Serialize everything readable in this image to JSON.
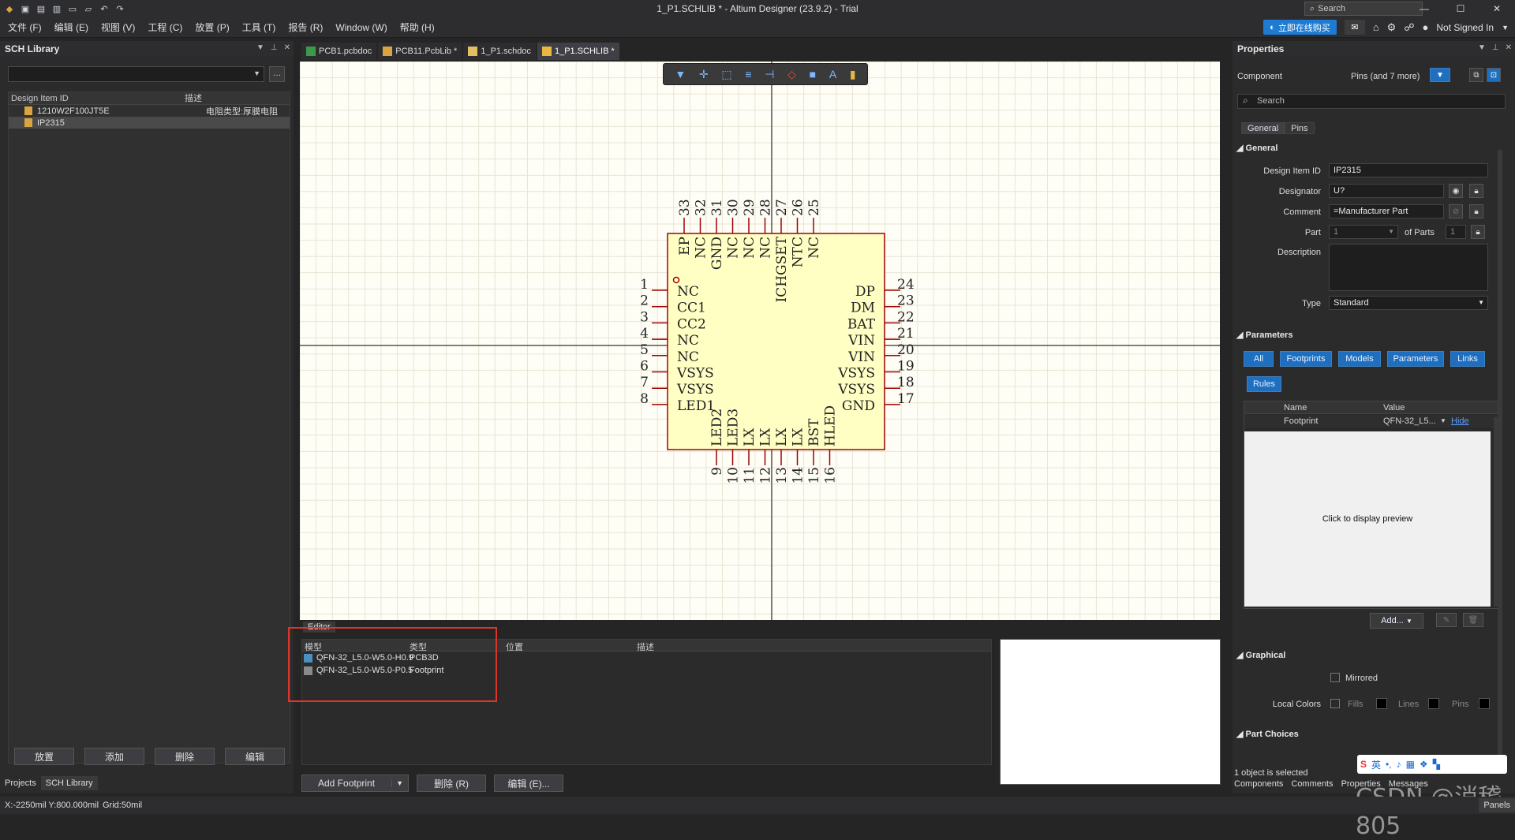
{
  "app": {
    "title": "1_P1.SCHLIB * - Altium Designer (23.9.2) - Trial",
    "search_placeholder": "Search",
    "buy_label": "立即在线购买",
    "signed_in": "Not Signed In"
  },
  "menu": [
    "文件 (F)",
    "编辑 (E)",
    "视图 (V)",
    "工程 (C)",
    "放置 (P)",
    "工具 (T)",
    "报告 (R)",
    "Window (W)",
    "帮助 (H)"
  ],
  "left_panel": {
    "title": "SCH Library",
    "col_id": "Design Item ID",
    "col_desc": "描述",
    "items": [
      {
        "id": "1210W2F100JT5E",
        "desc": "电阻类型:厚膜电阻"
      },
      {
        "id": "IP2315",
        "desc": ""
      }
    ],
    "buttons": [
      "放置",
      "添加",
      "删除",
      "编辑"
    ],
    "tabs": [
      "Projects",
      "SCH Library"
    ]
  },
  "doc_tabs": [
    "PCB1.pcbdoc",
    "PCB11.PcbLib *",
    "1_P1.schdoc",
    "1_P1.SCHLIB *"
  ],
  "component": {
    "top_pin_numbers": [
      "33",
      "32",
      "31",
      "30",
      "29",
      "28",
      "27",
      "26",
      "25"
    ],
    "top_pin_names": [
      "EP",
      "NC",
      "GND",
      "NC",
      "NC",
      "NC",
      "ICHGSET",
      "NTC",
      "NC"
    ],
    "left_pin_numbers": [
      "1",
      "2",
      "3",
      "4",
      "5",
      "6",
      "7",
      "8"
    ],
    "left_pin_names": [
      "NC",
      "CC1",
      "CC2",
      "NC",
      "NC",
      "VSYS",
      "VSYS",
      "LED1"
    ],
    "right_pin_numbers": [
      "24",
      "23",
      "22",
      "21",
      "20",
      "19",
      "18",
      "17"
    ],
    "right_pin_names": [
      "DP",
      "DM",
      "BAT",
      "VIN",
      "VIN",
      "VSYS",
      "VSYS",
      "GND"
    ],
    "bottom_pin_numbers": [
      "9",
      "10",
      "11",
      "12",
      "13",
      "14",
      "15",
      "16"
    ],
    "bottom_pin_names": [
      "LED2",
      "LED3",
      "LX",
      "LX",
      "LX",
      "LX",
      "BST",
      "HLED"
    ]
  },
  "editor": {
    "label": "Editor",
    "col_model": "模型",
    "col_type": "类型",
    "col_pos": "位置",
    "col_desc": "描述",
    "rows": [
      {
        "model": "QFN-32_L5.0-W5.0-H0.9",
        "type": "PCB3D"
      },
      {
        "model": "QFN-32_L5.0-W5.0-P0.5",
        "type": "Footprint"
      }
    ],
    "add_footprint": "Add Footprint",
    "delete": "删除 (R)",
    "edit": "编辑 (E)..."
  },
  "properties": {
    "title": "Properties",
    "component_label": "Component",
    "pins_label": "Pins (and 7 more)",
    "search_placeholder": "Search",
    "tabs": [
      "General",
      "Pins"
    ],
    "general_section": "General",
    "design_item_id_label": "Design Item ID",
    "design_item_id": "IP2315",
    "designator_label": "Designator",
    "designator": "U?",
    "comment_label": "Comment",
    "comment": "=Manufacturer Part",
    "part_label": "Part",
    "part": "1",
    "of_parts_label": "of Parts",
    "of_parts": "1",
    "description_label": "Description",
    "type_label": "Type",
    "type": "Standard",
    "parameters_section": "Parameters",
    "param_buttons": [
      "All",
      "Footprints",
      "Models",
      "Parameters",
      "Links",
      "Rules"
    ],
    "param_col_name": "Name",
    "param_col_value": "Value",
    "param_row_name": "Footprint",
    "param_row_value": "QFN-32_L5...",
    "param_row_hide": "Hide",
    "preview_text": "Click to display preview",
    "add_button": "Add...",
    "graphical_section": "Graphical",
    "mirrored_label": "Mirrored",
    "local_colors_label": "Local Colors",
    "fills_label": "Fills",
    "lines_label": "Lines",
    "pins_label2": "Pins",
    "part_choices_section": "Part Choices",
    "selected_status": "1 object is selected",
    "bottom_tabs": [
      "Components",
      "Comments",
      "Properties",
      "Messages"
    ]
  },
  "status": {
    "coords": "X:-2250mil Y:800.000mil",
    "grid": "Grid:50mil",
    "panels": "Panels"
  },
  "watermark": "CSDN @消稽805",
  "colors": {
    "accent": "#1e7bd1",
    "pin": "#a00000",
    "body": "#ffffc4",
    "highlight": "#e0332a"
  }
}
